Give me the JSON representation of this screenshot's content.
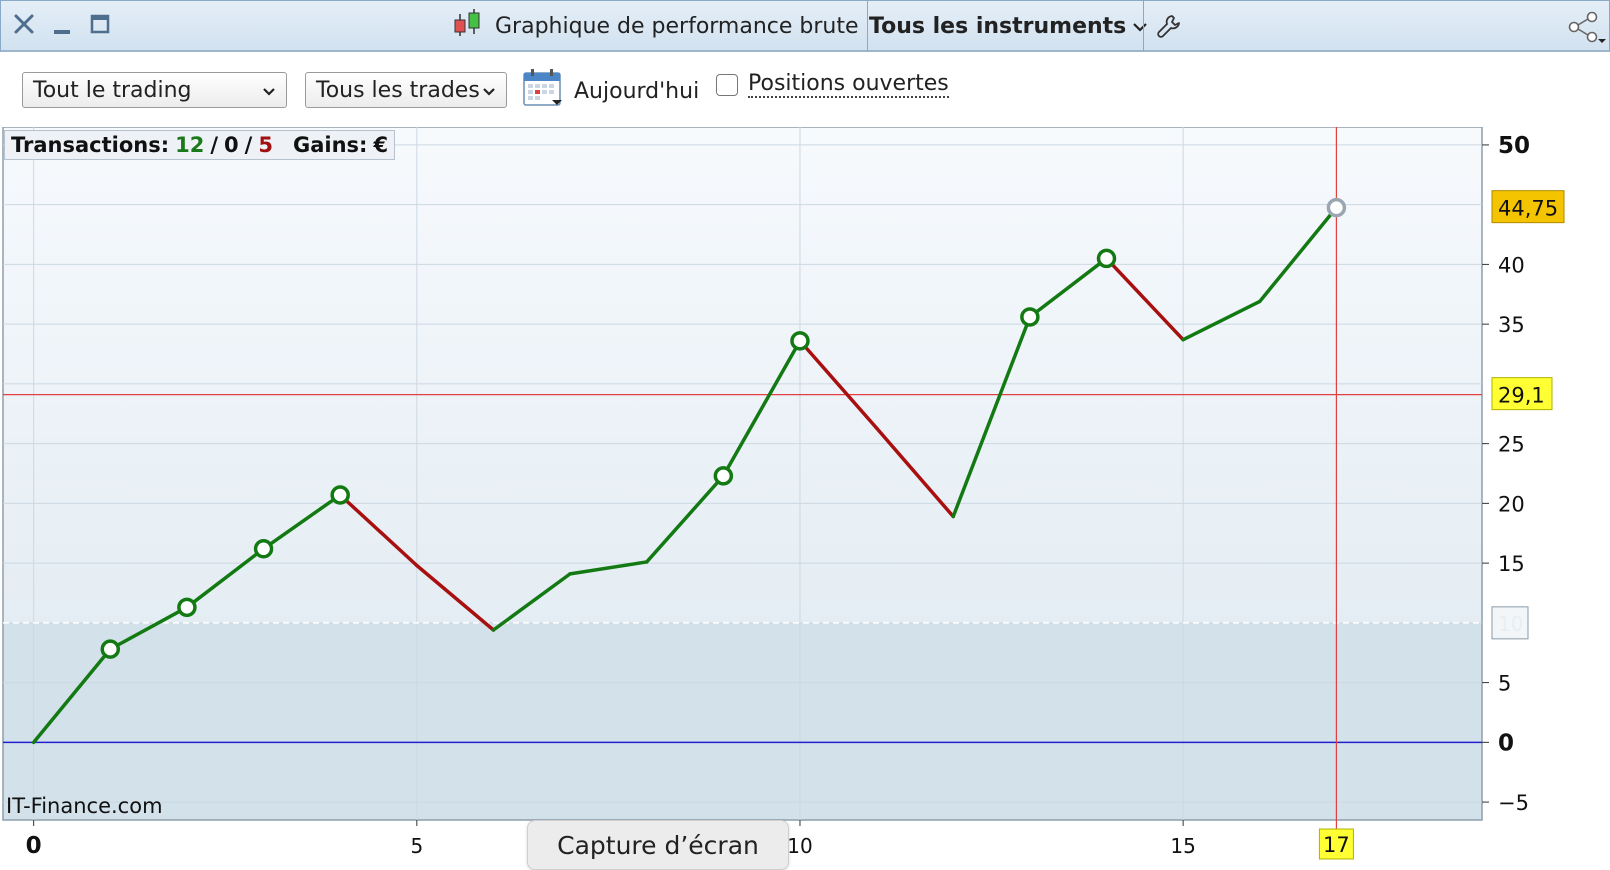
{
  "window": {
    "title": "Graphique de performance brute",
    "instrument_selector": "Tous les instruments"
  },
  "toolbar": {
    "trading_select": "Tout le trading",
    "trades_select": "Tous les trades",
    "today_label": "Aujourd'hui",
    "open_positions_label": "Positions ouvertes",
    "open_positions_checked": false
  },
  "summary": {
    "transactions_label": "Transactions:",
    "wins": "12",
    "sep1": "/",
    "neutral": "0",
    "sep2": "/",
    "losses": "5",
    "gains_label": "Gains:",
    "currency": "€"
  },
  "watermark": "IT-Finance.com",
  "tooltip": "Capture d’écran",
  "colors": {
    "win_line": "#137a13",
    "loss_line": "#a81010",
    "zero_line": "#2020d0",
    "cursor_line": "#e04040",
    "label_gold": "#f5c400",
    "label_yellow": "#ffff33"
  },
  "chart_data": {
    "type": "line",
    "xlim": [
      -0.4,
      18.9
    ],
    "ylim": [
      -6.5,
      51.5
    ],
    "x_ticks": [
      "0",
      "5",
      "10",
      "15"
    ],
    "y_ticks": [
      "50",
      "40",
      "35",
      "25",
      "20",
      "15",
      "5",
      "0",
      "−5"
    ],
    "reference_lines": {
      "zero": 0,
      "average": 10,
      "average_label": "10",
      "cursor_y": 29.1,
      "cursor_y_label": "29,1",
      "cursor_x": 17,
      "cursor_x_label": "17"
    },
    "last_value_label": "44,75",
    "points": [
      {
        "x": 0,
        "y": 0,
        "marker": false
      },
      {
        "x": 1,
        "y": 7.8,
        "marker": true
      },
      {
        "x": 2,
        "y": 11.3,
        "marker": true
      },
      {
        "x": 3,
        "y": 16.2,
        "marker": true
      },
      {
        "x": 4,
        "y": 20.7,
        "marker": true
      },
      {
        "x": 5,
        "y": 14.8,
        "marker": false
      },
      {
        "x": 6,
        "y": 9.4,
        "marker": false
      },
      {
        "x": 7,
        "y": 14.1,
        "marker": false
      },
      {
        "x": 8,
        "y": 15.1,
        "marker": false
      },
      {
        "x": 9,
        "y": 22.3,
        "marker": true
      },
      {
        "x": 10,
        "y": 33.6,
        "marker": true
      },
      {
        "x": 11,
        "y": 26.3,
        "marker": false
      },
      {
        "x": 12,
        "y": 18.9,
        "marker": false
      },
      {
        "x": 13,
        "y": 35.6,
        "marker": true
      },
      {
        "x": 14,
        "y": 40.5,
        "marker": true
      },
      {
        "x": 15,
        "y": 33.7,
        "marker": false
      },
      {
        "x": 16,
        "y": 36.9,
        "marker": false
      },
      {
        "x": 17,
        "y": 44.75,
        "marker": true,
        "last": true
      }
    ],
    "segments": [
      "up",
      "up",
      "up",
      "up",
      "down",
      "down",
      "up",
      "up",
      "up",
      "up",
      "down",
      "down",
      "up",
      "up",
      "down",
      "up",
      "up"
    ]
  }
}
